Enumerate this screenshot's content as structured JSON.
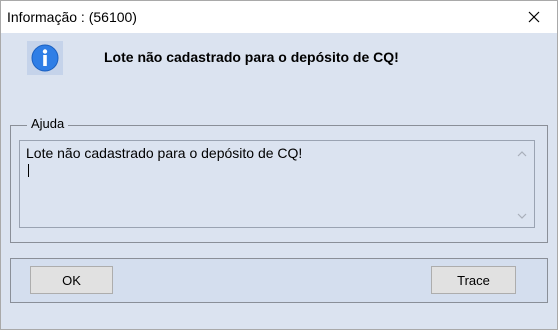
{
  "window": {
    "title": "Informação : (56100)",
    "message": "Lote não cadastrado para o depósito de CQ!"
  },
  "help": {
    "label": "Ajuda",
    "text": "Lote não cadastrado para o depósito de CQ!"
  },
  "buttons": {
    "ok_label": "OK",
    "trace_label": "Trace"
  },
  "icons": {
    "header": "info-icon",
    "close": "close-icon"
  },
  "colors": {
    "dialog_background": "#dbe3f0",
    "info_icon": "#2f7ee6"
  }
}
